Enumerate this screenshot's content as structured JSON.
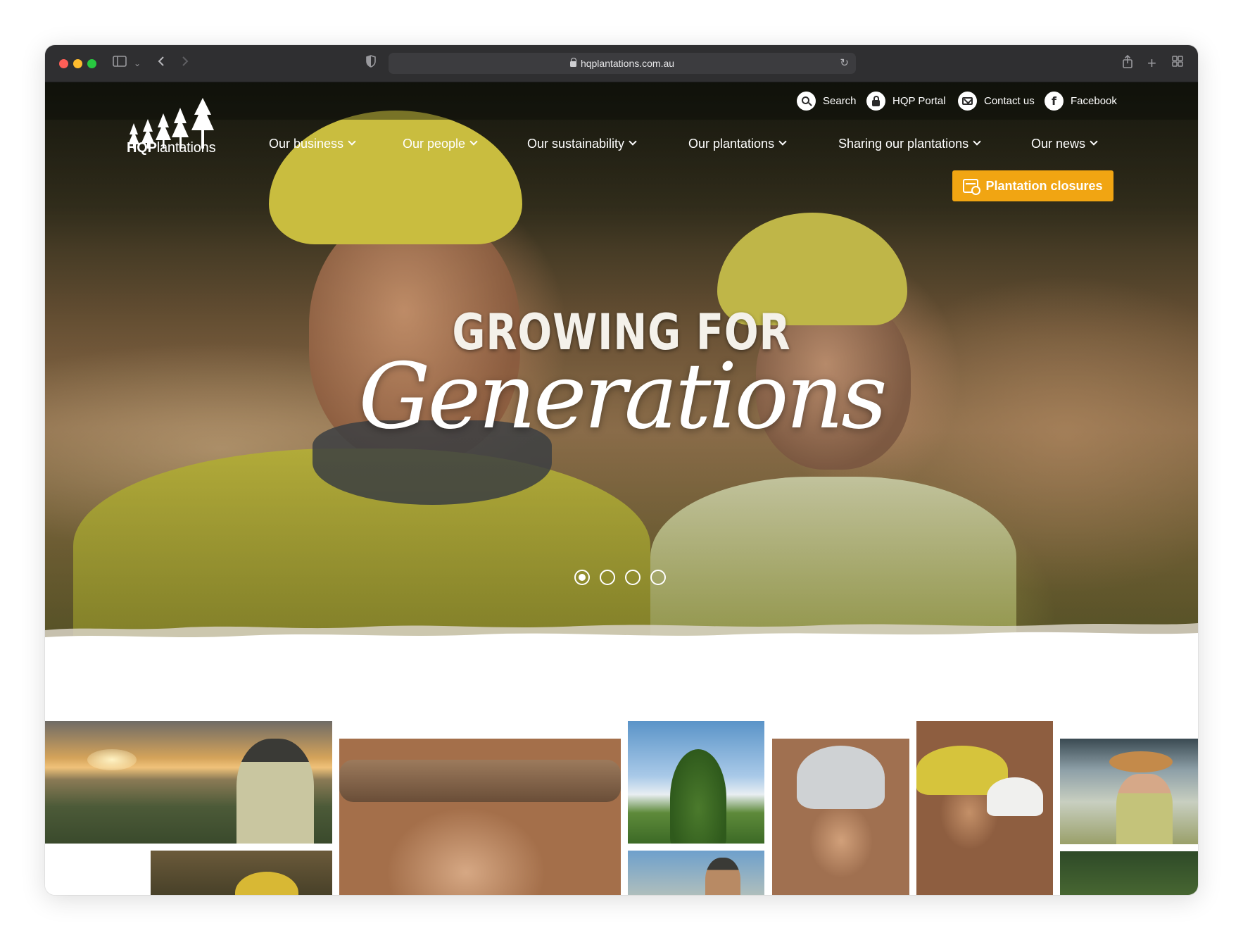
{
  "browser": {
    "url": "hqplantations.com.au"
  },
  "utility_nav": [
    {
      "label": "Search",
      "icon": "search-icon"
    },
    {
      "label": "HQP Portal",
      "icon": "lock-icon"
    },
    {
      "label": "Contact us",
      "icon": "mail-icon"
    },
    {
      "label": "Facebook",
      "icon": "facebook-icon"
    }
  ],
  "logo": {
    "bold": "HQP",
    "regular": "lantations"
  },
  "main_nav": [
    {
      "label": "Our business"
    },
    {
      "label": "Our people"
    },
    {
      "label": "Our sustainability"
    },
    {
      "label": "Our plantations"
    },
    {
      "label": "Sharing our plantations"
    },
    {
      "label": "Our news"
    }
  ],
  "cta": {
    "label": "Plantation closures",
    "icon": "calendar-icon",
    "color": "#f1a512"
  },
  "hero": {
    "headline_top": "GROWING FOR",
    "headline_script": "Generations",
    "slides_total": 4,
    "active_slide": 1
  },
  "colors": {
    "accent": "#f1a512",
    "chrome": "#2f2f31"
  }
}
